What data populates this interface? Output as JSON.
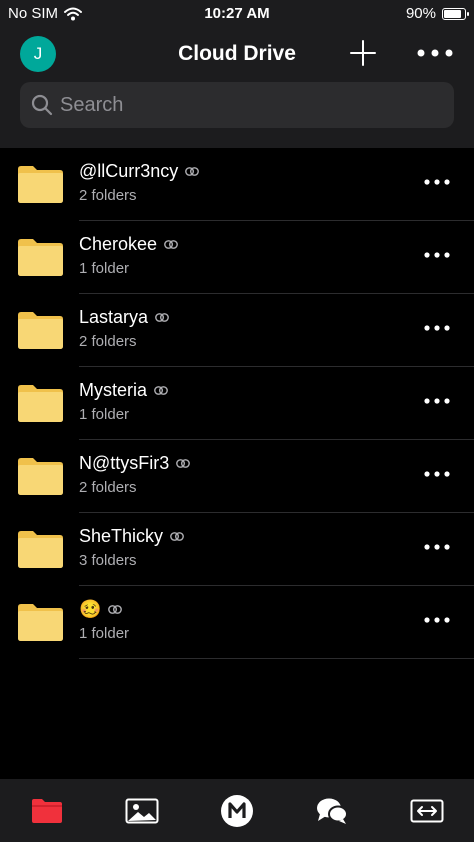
{
  "status": {
    "carrier": "No SIM",
    "time": "10:27 AM",
    "battery_text": "90%",
    "battery_level": 0.9
  },
  "header": {
    "avatar_initial": "J",
    "title": "Cloud Drive"
  },
  "search": {
    "placeholder": "Search"
  },
  "items": [
    {
      "name": "@llCurr3ncy",
      "sub": "2 folders"
    },
    {
      "name": "Cherokee",
      "sub": "1 folder"
    },
    {
      "name": "Lastarya",
      "sub": "2 folders"
    },
    {
      "name": "Mysteria",
      "sub": "1 folder"
    },
    {
      "name": "N@ttysFir3",
      "sub": "2 folders"
    },
    {
      "name": "SheThicky",
      "sub": "3 folders"
    },
    {
      "name": "🥴",
      "sub": "1 folder"
    }
  ],
  "tabs": [
    {
      "icon": "folder-icon",
      "active": true
    },
    {
      "icon": "photos-icon",
      "active": false
    },
    {
      "icon": "mega-logo-icon",
      "active": false
    },
    {
      "icon": "chat-icon",
      "active": false
    },
    {
      "icon": "transfers-icon",
      "active": false
    }
  ],
  "colors": {
    "accent": "#f0313c",
    "avatar": "#00a89a",
    "folder": "#f8d775",
    "folder_back": "#f0c14b"
  }
}
